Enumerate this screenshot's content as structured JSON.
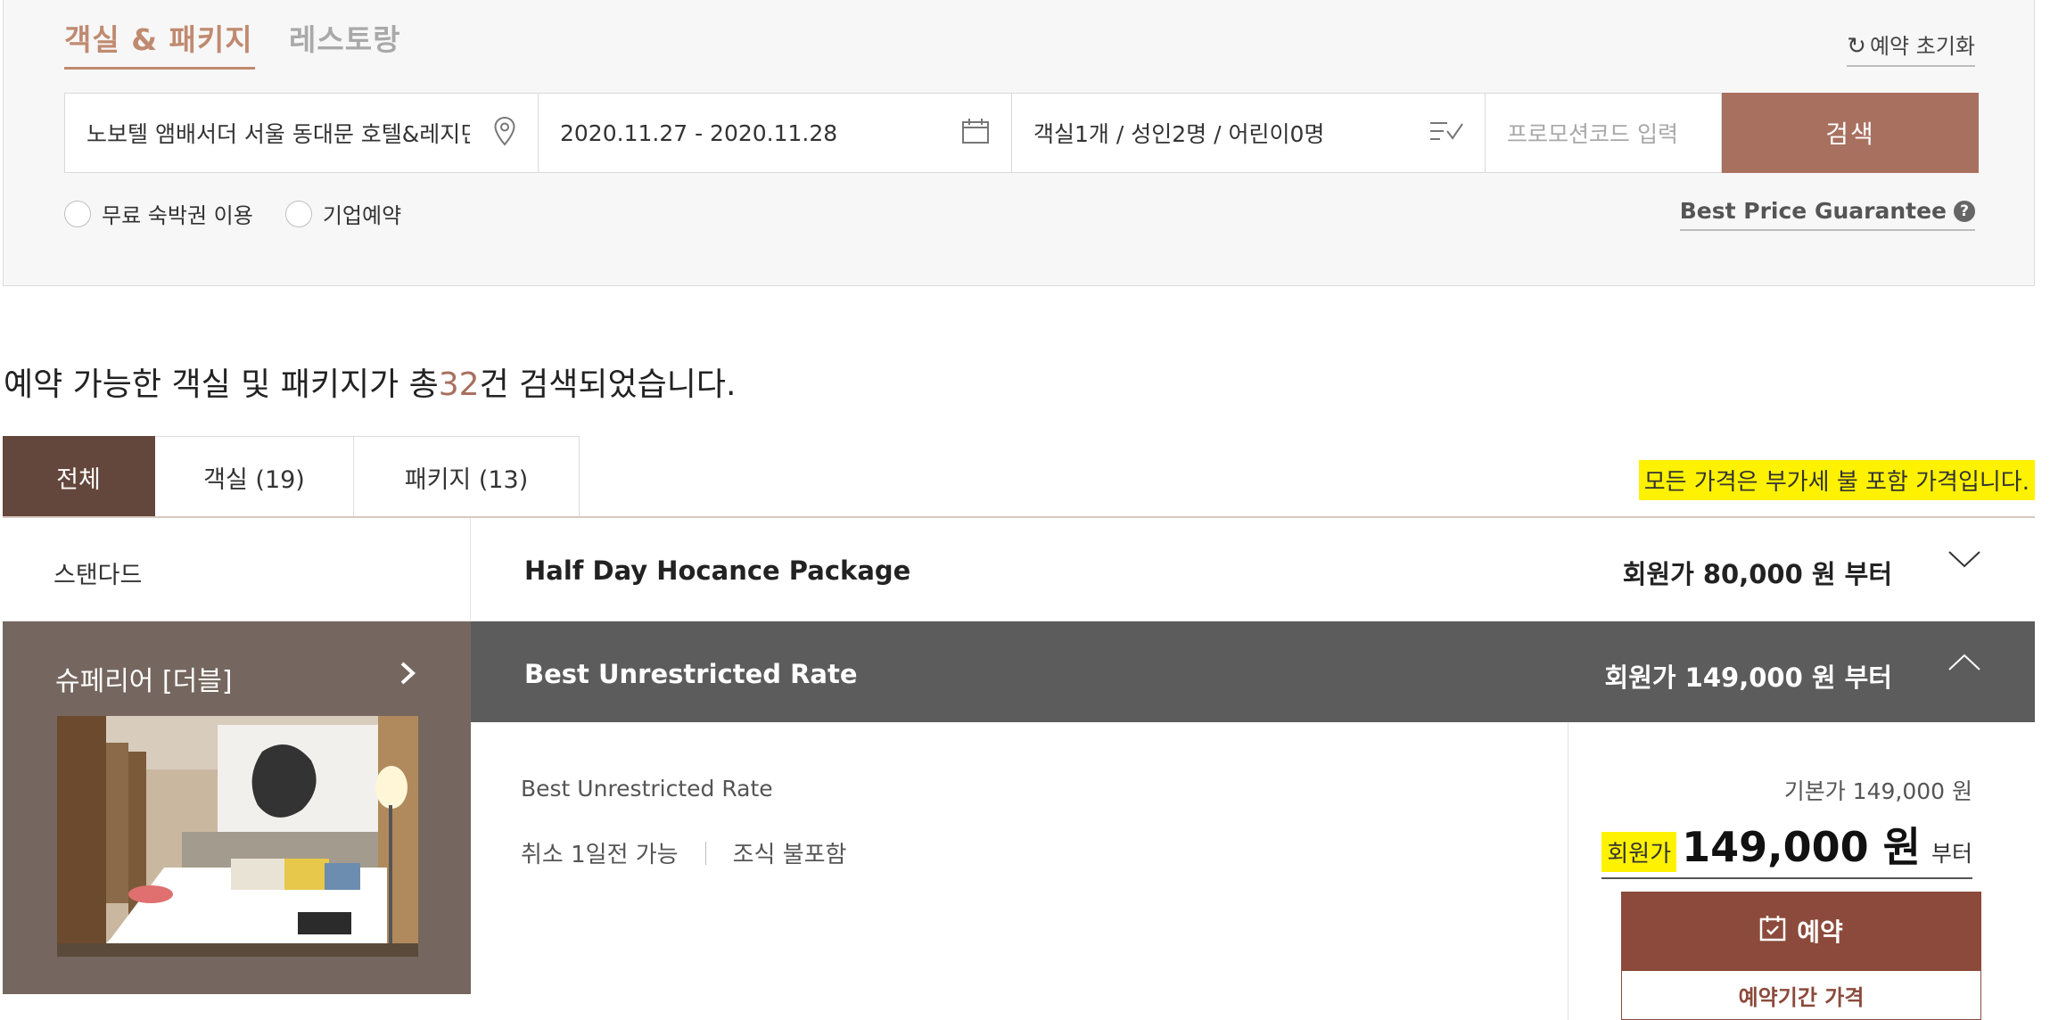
{
  "search_tabs": {
    "rooms": "객실 & 패키지",
    "restaurant": "레스토랑"
  },
  "reset": {
    "icon": "refresh-icon",
    "label": "예약 초기화"
  },
  "search": {
    "hotel": "노보텔 앰배서더 서울 동대문 호텔&레지던스",
    "dates": "2020.11.27 - 2020.11.28",
    "guests": "객실1개 / 성인2명 / 어린이0명",
    "promo_placeholder": "프로모션코드 입력",
    "search_label": "검색"
  },
  "options": {
    "free_voucher": "무료 숙박권 이용",
    "corporate": "기업예약"
  },
  "best_price": "Best Price Guarantee",
  "result": {
    "prefix": "예약 가능한 객실 및 패키지가 총",
    "count": "32",
    "suffix": "건 검색되었습니다."
  },
  "tabs": [
    {
      "label": "전체"
    },
    {
      "label": "객실 (19)"
    },
    {
      "label": "패키지 (13)"
    }
  ],
  "vat_note": "모든 가격은 부가세 불 포함 가격입니다.",
  "categories": {
    "standard": "스탠다드",
    "superior": "슈페리어 [더블]"
  },
  "packages": [
    {
      "name": "Half Day Hocance Package",
      "price": "회원가 80,000 원 부터"
    },
    {
      "name": "Best Unrestricted Rate",
      "price": "회원가 149,000 원 부터"
    }
  ],
  "detail": {
    "rate_name": "Best Unrestricted Rate",
    "cancel": "취소 1일전 가능",
    "breakfast": "조식 불포함",
    "base_price": "기본가 149,000 원",
    "member_label": "회원가",
    "member_price": "149,000 원",
    "from": "부터",
    "book_label": "예약",
    "period_label": "예약기간 가격"
  },
  "colors": {
    "accent": "#a8705f",
    "tab_active": "#64473c",
    "book": "#8b4a3b",
    "highlight": "#fff200"
  }
}
